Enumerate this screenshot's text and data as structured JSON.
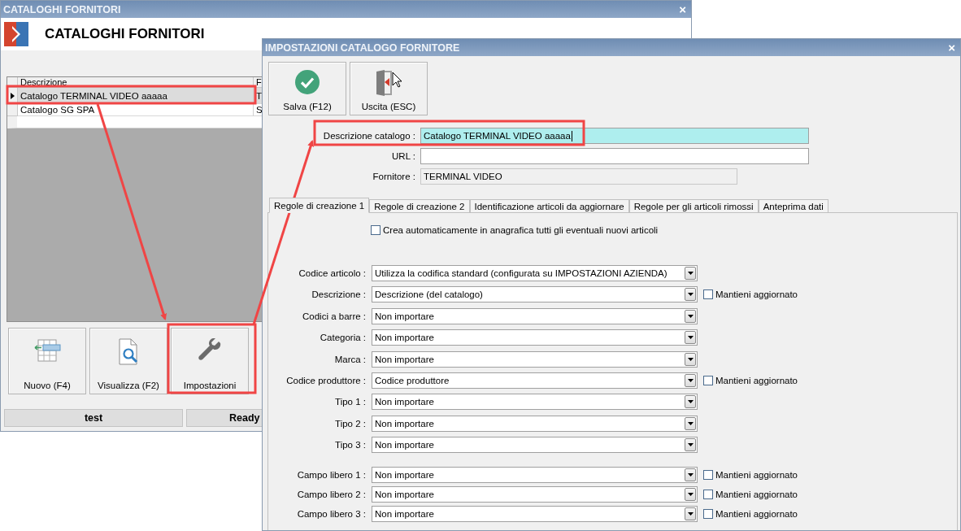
{
  "main_window": {
    "title": "CATALOGHI FORNITORI",
    "close": "×",
    "header_title": "CATALOGHI FORNITORI",
    "table": {
      "columns": [
        "Descrizione",
        "F"
      ],
      "rows": [
        {
          "cells": [
            "Catalogo TERMINAL VIDEO aaaaa",
            "T"
          ],
          "selected": true
        },
        {
          "cells": [
            "Catalogo SG SPA",
            "S"
          ],
          "selected": false
        }
      ]
    },
    "buttons": [
      {
        "label": "Nuovo (F4)",
        "kind": "new"
      },
      {
        "label": "Visualizza (F2)",
        "kind": "view"
      },
      {
        "label": "Impostazioni",
        "kind": "settings"
      }
    ],
    "status_bar": [
      "test",
      "Ready"
    ]
  },
  "dialog": {
    "title": "IMPOSTAZIONI CATALOGO FORNITORE",
    "close": "×",
    "toolbar": [
      {
        "label": "Salva (F12)",
        "kind": "save"
      },
      {
        "label": "Uscita (ESC)",
        "kind": "exit"
      }
    ],
    "form": [
      {
        "label": "Descrizione catalogo :",
        "value": "Catalogo TERMINAL VIDEO aaaaa",
        "kind": "focused"
      },
      {
        "label": "URL :",
        "kind": "normal"
      },
      {
        "label": "Fornitore :",
        "value": "TERMINAL VIDEO",
        "kind": "readonly"
      }
    ],
    "tabs": [
      {
        "label": "Regole di creazione 1",
        "selected": true
      },
      {
        "label": "Regole di creazione 2",
        "selected": false
      },
      {
        "label": "Identificazione articoli da aggiornare",
        "selected": false
      },
      {
        "label": "Regole per gli articoli rimossi",
        "selected": false
      },
      {
        "label": "Anteprima dati",
        "selected": false
      }
    ],
    "auto_create": {
      "label": "Crea automaticamente in anagrafica tutti gli eventuali nuovi articoli",
      "checked": false
    },
    "rules": [
      {
        "label": "Codice articolo :",
        "value": "Utilizza la codifica standard (configurata su IMPOSTAZIONI AZIENDA)"
      },
      {
        "label": "Descrizione :",
        "value": "Descrizione (del catalogo)",
        "keep_updated": {
          "label": "Mantieni aggiornato",
          "checked": false
        }
      },
      {
        "label": "Codici a barre :",
        "value": "Non importare"
      },
      {
        "label": "Categoria :",
        "value": "Non importare"
      },
      {
        "label": "Marca :",
        "value": "Non importare"
      },
      {
        "label": "Codice produttore :",
        "value": "Codice produttore",
        "keep_updated": {
          "label": "Mantieni aggiornato",
          "checked": false
        }
      },
      {
        "label": "Tipo 1 :",
        "value": "Non importare"
      },
      {
        "label": "Tipo 2 :",
        "value": "Non importare"
      },
      {
        "label": "Tipo 3 :",
        "value": "Non importare"
      }
    ],
    "custom_fields": [
      {
        "label": "Campo libero 1 :",
        "value": "Non importare",
        "keep_updated": {
          "label": "Mantieni aggiornato",
          "checked": false
        }
      },
      {
        "label": "Campo libero 2 :",
        "value": "Non importare",
        "keep_updated": {
          "label": "Mantieni aggiornato",
          "checked": false
        }
      },
      {
        "label": "Campo libero 3 :",
        "value": "Non importare",
        "keep_updated": {
          "label": "Mantieni aggiornato",
          "checked": false
        }
      }
    ]
  }
}
